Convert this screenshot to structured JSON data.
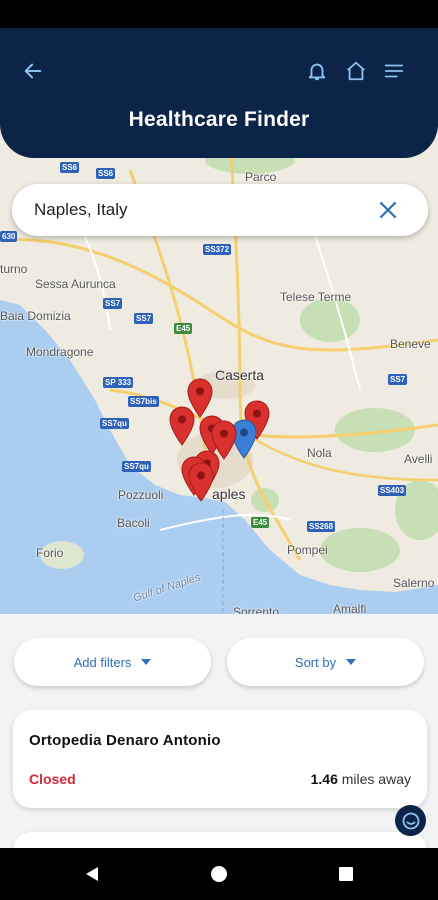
{
  "header": {
    "title": "Healthcare Finder",
    "icons": [
      "back-arrow-icon",
      "bell-icon",
      "home-icon",
      "hamburger-menu-icon"
    ]
  },
  "search": {
    "value": "Naples, Italy"
  },
  "map": {
    "labels": {
      "parco": "Parco",
      "turno": "turno",
      "sessa": "Sessa Aurunca",
      "domizia": "Baia Domizia",
      "mondragone": "Mondragone",
      "telese": "Telese Terme",
      "beneve": "Beneve",
      "caserta": "Caserta",
      "nola": "Nola",
      "avelli": "Avelli",
      "naples": "aples",
      "pozzuoli": "Pozzuoli",
      "bacoli": "Bacoli",
      "forio": "Forio",
      "pompei": "Pompei",
      "salerno": "Salerno",
      "amalfi": "Amalfi",
      "sorrento": "Sorrento",
      "gulf": "Gulf of Naples"
    },
    "shields": {
      "ss6a": "SS6",
      "ss6b": "SS6",
      "ss630": "630",
      "ss372": "SS372",
      "ss7a": "SS7",
      "ss7b": "SS7",
      "e45a": "E45",
      "sp333": "SP 333",
      "ss7bis": "SS7bis",
      "ss7q": "SS7qu",
      "ss7quater": "SS7qu",
      "ss7r": "SS7",
      "ss403": "SS403",
      "ss268": "SS268",
      "e45b": "E45"
    }
  },
  "filters": {
    "add_filters": "Add filters",
    "sort_by": "Sort by"
  },
  "results": [
    {
      "name": "Ortopedia Denaro Antonio",
      "status": "Closed",
      "distance_value": "1.46",
      "distance_unit": "miles away"
    }
  ],
  "colors": {
    "header": "#0c2447",
    "accent": "#2e6fb5",
    "closed": "#d0283c",
    "pin_red": "#d9322e",
    "pin_blue": "#3b7fd4"
  }
}
